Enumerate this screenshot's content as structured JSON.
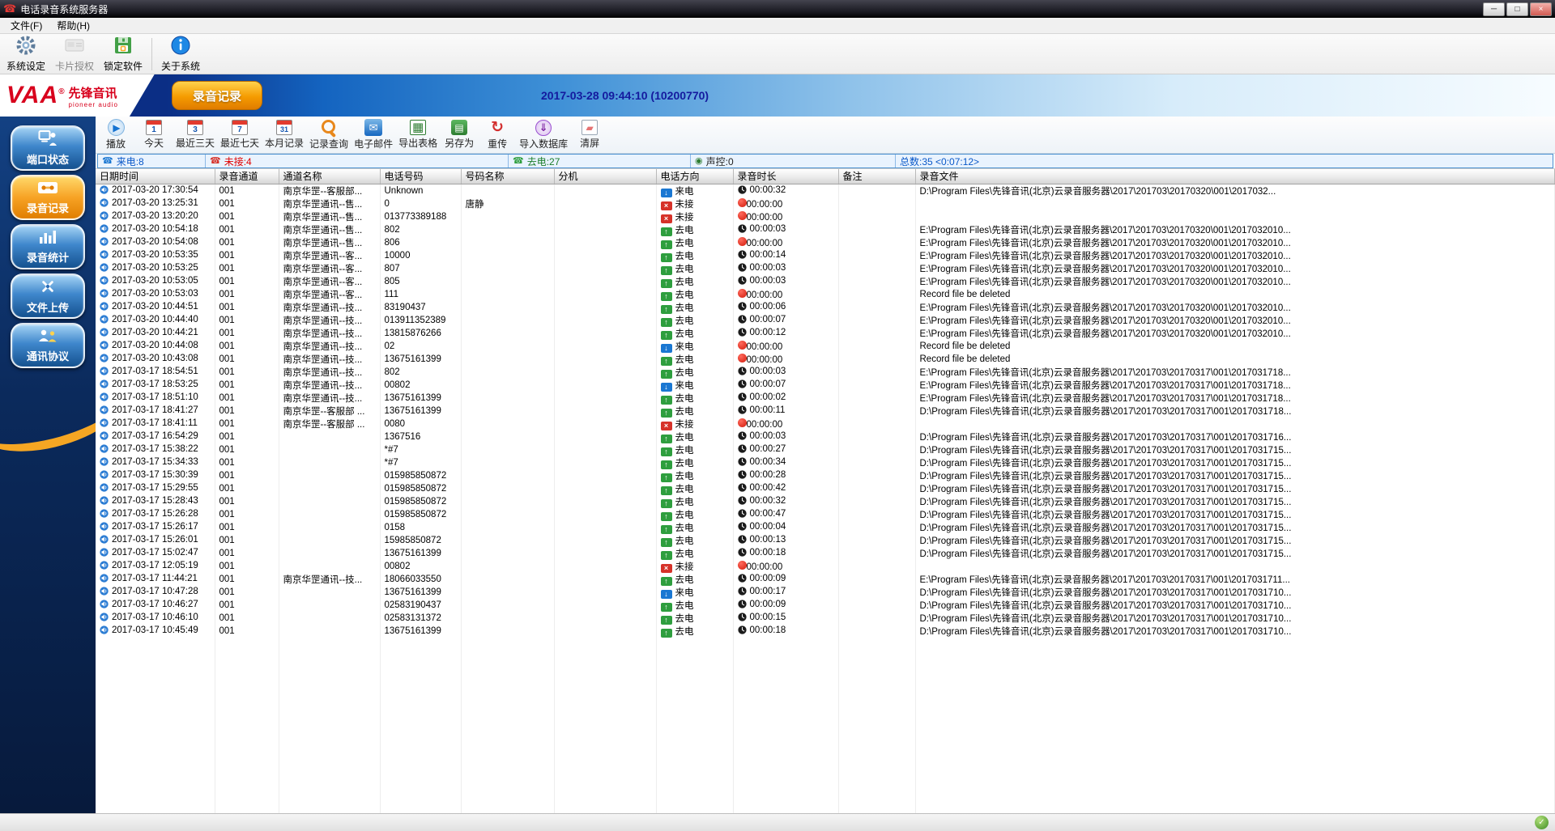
{
  "window": {
    "title": "电话录音系统服务器"
  },
  "menubar": {
    "items": [
      {
        "label": "文件(F)"
      },
      {
        "label": "帮助(H)"
      }
    ]
  },
  "toolbar1": {
    "items": [
      {
        "label": "系统设定"
      },
      {
        "label": "卡片授权"
      },
      {
        "label": "锁定软件"
      },
      {
        "label": "关于系统"
      }
    ]
  },
  "banner": {
    "logo_text": "VAA",
    "logo_reg": "®",
    "logo_cn": "先锋音讯",
    "logo_sub": "pioneer audio",
    "tab": "录音记录",
    "timestamp": "2017-03-28 09:44:10 (10200770)"
  },
  "sidebar": {
    "items": [
      {
        "label": "端口状态"
      },
      {
        "label": "录音记录",
        "active": true
      },
      {
        "label": "录音统计"
      },
      {
        "label": "文件上传"
      },
      {
        "label": "通讯协议"
      }
    ]
  },
  "toolbar2": {
    "items": [
      {
        "label": "播放"
      },
      {
        "label": "今天"
      },
      {
        "label": "最近三天"
      },
      {
        "label": "最近七天"
      },
      {
        "label": "本月记录"
      },
      {
        "label": "记录查询"
      },
      {
        "label": "电子邮件"
      },
      {
        "label": "导出表格"
      },
      {
        "label": "另存为"
      },
      {
        "label": "重传"
      },
      {
        "label": "导入数据库"
      },
      {
        "label": "清屏"
      }
    ]
  },
  "summary": {
    "segments": [
      {
        "label": "来电:8",
        "type": "incoming"
      },
      {
        "label": "未接:4",
        "type": "missed"
      },
      {
        "label": "去电:27",
        "type": "outgoing"
      },
      {
        "label": "声控:0",
        "type": "voice"
      },
      {
        "label": "总数:35 <0:07:12>",
        "type": "total"
      }
    ]
  },
  "colors": {
    "brand_red": "#d8001c",
    "accent_orange": "#f59b00",
    "banner_blue": "#1464c0",
    "incoming_blue": "#1a77d2",
    "outgoing_green": "#2e9e3e",
    "missed_red": "#d63229"
  },
  "table": {
    "columns": [
      "日期时间",
      "录音通道",
      "通道名称",
      "电话号码",
      "号码名称",
      "分机",
      "电话方向",
      "录音时长",
      "备注",
      "录音文件"
    ],
    "rows": [
      [
        "2017-03-20 17:30:54",
        "001",
        "南京华罡--客服部...",
        "Unknown",
        "",
        "",
        "来电",
        "00:00:32",
        "",
        "D:\\Program Files\\先锋音讯(北京)云录音服务器\\2017\\201703\\20170320\\001\\2017032..."
      ],
      [
        "2017-03-20 13:25:31",
        "001",
        "南京华罡通讯--售...",
        "0",
        "唐静",
        "",
        "未接",
        "00:00:00",
        "",
        ""
      ],
      [
        "2017-03-20 13:20:20",
        "001",
        "南京华罡通讯--售...",
        "013773389188",
        "",
        "",
        "未接",
        "00:00:00",
        "",
        ""
      ],
      [
        "2017-03-20 10:54:18",
        "001",
        "南京华罡通讯--售...",
        "802",
        "",
        "",
        "去电",
        "00:00:03",
        "",
        "E:\\Program Files\\先锋音讯(北京)云录音服务器\\2017\\201703\\20170320\\001\\2017032010..."
      ],
      [
        "2017-03-20 10:54:08",
        "001",
        "南京华罡通讯--售...",
        "806",
        "",
        "",
        "去电",
        "00:00:00",
        "",
        "E:\\Program Files\\先锋音讯(北京)云录音服务器\\2017\\201703\\20170320\\001\\2017032010..."
      ],
      [
        "2017-03-20 10:53:35",
        "001",
        "南京华罡通讯--客...",
        "10000",
        "",
        "",
        "去电",
        "00:00:14",
        "",
        "E:\\Program Files\\先锋音讯(北京)云录音服务器\\2017\\201703\\20170320\\001\\2017032010..."
      ],
      [
        "2017-03-20 10:53:25",
        "001",
        "南京华罡通讯--客...",
        "807",
        "",
        "",
        "去电",
        "00:00:03",
        "",
        "E:\\Program Files\\先锋音讯(北京)云录音服务器\\2017\\201703\\20170320\\001\\2017032010..."
      ],
      [
        "2017-03-20 10:53:05",
        "001",
        "南京华罡通讯--客...",
        "805",
        "",
        "",
        "去电",
        "00:00:03",
        "",
        "E:\\Program Files\\先锋音讯(北京)云录音服务器\\2017\\201703\\20170320\\001\\2017032010..."
      ],
      [
        "2017-03-20 10:53:03",
        "001",
        "南京华罡通讯--客...",
        "111",
        "",
        "",
        "去电",
        "00:00:00",
        "",
        "Record file be deleted"
      ],
      [
        "2017-03-20 10:44:51",
        "001",
        "南京华罡通讯--技...",
        "83190437",
        "",
        "",
        "去电",
        "00:00:06",
        "",
        "E:\\Program Files\\先锋音讯(北京)云录音服务器\\2017\\201703\\20170320\\001\\2017032010..."
      ],
      [
        "2017-03-20 10:44:40",
        "001",
        "南京华罡通讯--技...",
        "013911352389",
        "",
        "",
        "去电",
        "00:00:07",
        "",
        "E:\\Program Files\\先锋音讯(北京)云录音服务器\\2017\\201703\\20170320\\001\\2017032010..."
      ],
      [
        "2017-03-20 10:44:21",
        "001",
        "南京华罡通讯--技...",
        "13815876266",
        "",
        "",
        "去电",
        "00:00:12",
        "",
        "E:\\Program Files\\先锋音讯(北京)云录音服务器\\2017\\201703\\20170320\\001\\2017032010..."
      ],
      [
        "2017-03-20 10:44:08",
        "001",
        "南京华罡通讯--技...",
        "02",
        "",
        "",
        "来电",
        "00:00:00",
        "",
        "Record file be deleted"
      ],
      [
        "2017-03-20 10:43:08",
        "001",
        "南京华罡通讯--技...",
        "13675161399",
        "",
        "",
        "去电",
        "00:00:00",
        "",
        "Record file be deleted"
      ],
      [
        "2017-03-17 18:54:51",
        "001",
        "南京华罡通讯--技...",
        "802",
        "",
        "",
        "去电",
        "00:00:03",
        "",
        "E:\\Program Files\\先锋音讯(北京)云录音服务器\\2017\\201703\\20170317\\001\\2017031718..."
      ],
      [
        "2017-03-17 18:53:25",
        "001",
        "南京华罡通讯--技...",
        "00802",
        "",
        "",
        "来电",
        "00:00:07",
        "",
        "E:\\Program Files\\先锋音讯(北京)云录音服务器\\2017\\201703\\20170317\\001\\2017031718..."
      ],
      [
        "2017-03-17 18:51:10",
        "001",
        "南京华罡通讯--技...",
        "13675161399",
        "",
        "",
        "去电",
        "00:00:02",
        "",
        "E:\\Program Files\\先锋音讯(北京)云录音服务器\\2017\\201703\\20170317\\001\\2017031718..."
      ],
      [
        "2017-03-17 18:41:27",
        "001",
        "南京华罡--客服部 ...",
        "13675161399",
        "",
        "",
        "去电",
        "00:00:11",
        "",
        "D:\\Program Files\\先锋音讯(北京)云录音服务器\\2017\\201703\\20170317\\001\\2017031718..."
      ],
      [
        "2017-03-17 18:41:11",
        "001",
        "南京华罡--客服部 ...",
        "0080",
        "",
        "",
        "未接",
        "00:00:00",
        "",
        ""
      ],
      [
        "2017-03-17 16:54:29",
        "001",
        "",
        "1367516",
        "",
        "",
        "去电",
        "00:00:03",
        "",
        "D:\\Program Files\\先锋音讯(北京)云录音服务器\\2017\\201703\\20170317\\001\\2017031716..."
      ],
      [
        "2017-03-17 15:38:22",
        "001",
        "",
        "*#7",
        "",
        "",
        "去电",
        "00:00:27",
        "",
        "D:\\Program Files\\先锋音讯(北京)云录音服务器\\2017\\201703\\20170317\\001\\2017031715..."
      ],
      [
        "2017-03-17 15:34:33",
        "001",
        "",
        "*#7",
        "",
        "",
        "去电",
        "00:00:34",
        "",
        "D:\\Program Files\\先锋音讯(北京)云录音服务器\\2017\\201703\\20170317\\001\\2017031715..."
      ],
      [
        "2017-03-17 15:30:39",
        "001",
        "",
        "015985850872",
        "",
        "",
        "去电",
        "00:00:28",
        "",
        "D:\\Program Files\\先锋音讯(北京)云录音服务器\\2017\\201703\\20170317\\001\\2017031715..."
      ],
      [
        "2017-03-17 15:29:55",
        "001",
        "",
        "015985850872",
        "",
        "",
        "去电",
        "00:00:42",
        "",
        "D:\\Program Files\\先锋音讯(北京)云录音服务器\\2017\\201703\\20170317\\001\\2017031715..."
      ],
      [
        "2017-03-17 15:28:43",
        "001",
        "",
        "015985850872",
        "",
        "",
        "去电",
        "00:00:32",
        "",
        "D:\\Program Files\\先锋音讯(北京)云录音服务器\\2017\\201703\\20170317\\001\\2017031715..."
      ],
      [
        "2017-03-17 15:26:28",
        "001",
        "",
        "015985850872",
        "",
        "",
        "去电",
        "00:00:47",
        "",
        "D:\\Program Files\\先锋音讯(北京)云录音服务器\\2017\\201703\\20170317\\001\\2017031715..."
      ],
      [
        "2017-03-17 15:26:17",
        "001",
        "",
        "0158",
        "",
        "",
        "去电",
        "00:00:04",
        "",
        "D:\\Program Files\\先锋音讯(北京)云录音服务器\\2017\\201703\\20170317\\001\\2017031715..."
      ],
      [
        "2017-03-17 15:26:01",
        "001",
        "",
        "15985850872",
        "",
        "",
        "去电",
        "00:00:13",
        "",
        "D:\\Program Files\\先锋音讯(北京)云录音服务器\\2017\\201703\\20170317\\001\\2017031715..."
      ],
      [
        "2017-03-17 15:02:47",
        "001",
        "",
        "13675161399",
        "",
        "",
        "去电",
        "00:00:18",
        "",
        "D:\\Program Files\\先锋音讯(北京)云录音服务器\\2017\\201703\\20170317\\001\\2017031715..."
      ],
      [
        "2017-03-17 12:05:19",
        "001",
        "",
        "00802",
        "",
        "",
        "未接",
        "00:00:00",
        "",
        ""
      ],
      [
        "2017-03-17 11:44:21",
        "001",
        "南京华罡通讯--技...",
        "18066033550",
        "",
        "",
        "去电",
        "00:00:09",
        "",
        "E:\\Program Files\\先锋音讯(北京)云录音服务器\\2017\\201703\\20170317\\001\\2017031711..."
      ],
      [
        "2017-03-17 10:47:28",
        "001",
        "",
        "13675161399",
        "",
        "",
        "来电",
        "00:00:17",
        "",
        "D:\\Program Files\\先锋音讯(北京)云录音服务器\\2017\\201703\\20170317\\001\\2017031710..."
      ],
      [
        "2017-03-17 10:46:27",
        "001",
        "",
        "02583190437",
        "",
        "",
        "去电",
        "00:00:09",
        "",
        "D:\\Program Files\\先锋音讯(北京)云录音服务器\\2017\\201703\\20170317\\001\\2017031710..."
      ],
      [
        "2017-03-17 10:46:10",
        "001",
        "",
        "02583131372",
        "",
        "",
        "去电",
        "00:00:15",
        "",
        "D:\\Program Files\\先锋音讯(北京)云录音服务器\\2017\\201703\\20170317\\001\\2017031710..."
      ],
      [
        "2017-03-17 10:45:49",
        "001",
        "",
        "13675161399",
        "",
        "",
        "去电",
        "00:00:18",
        "",
        "D:\\Program Files\\先锋音讯(北京)云录音服务器\\2017\\201703\\20170317\\001\\2017031710..."
      ]
    ]
  }
}
